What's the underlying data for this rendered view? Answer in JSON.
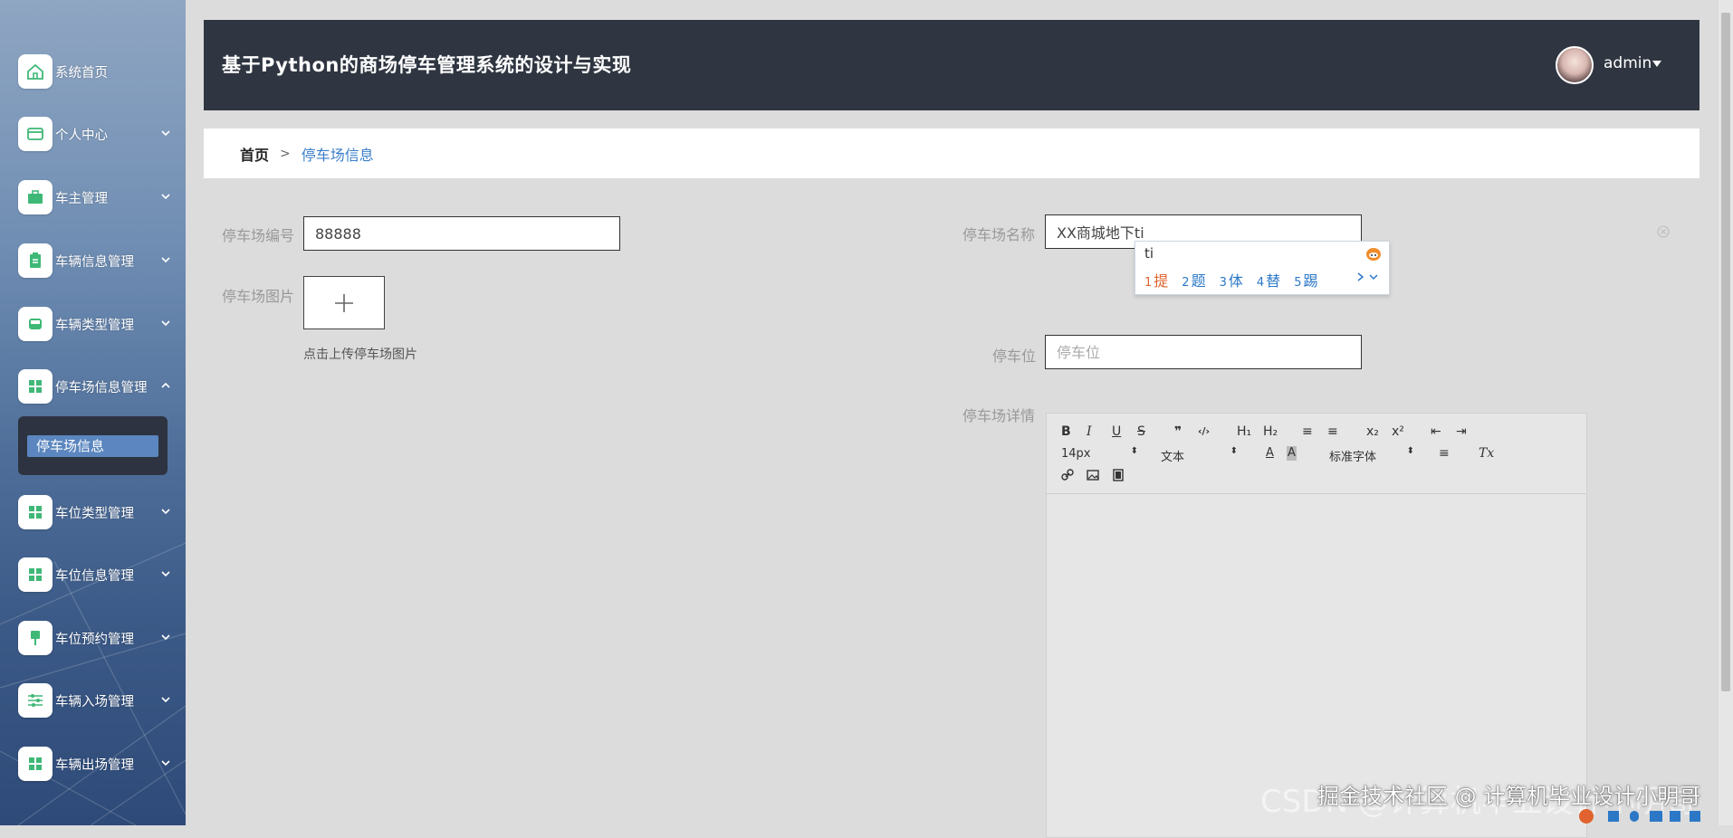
{
  "colors": {
    "header_bg": "#2f3641",
    "accent_link": "#3a7ec8",
    "submenu_active": "#5b86bf",
    "page_bg": "#dcdcdc"
  },
  "sidebar": {
    "items": [
      {
        "label": "系统首页",
        "icon": "home-icon"
      },
      {
        "label": "个人中心",
        "icon": "id-card-icon"
      },
      {
        "label": "车主管理",
        "icon": "briefcase-icon"
      },
      {
        "label": "车辆信息管理",
        "icon": "clipboard-icon"
      },
      {
        "label": "车辆类型管理",
        "icon": "car-icon"
      },
      {
        "label": "停车场信息管理",
        "icon": "grid-icon"
      },
      {
        "label": "车位类型管理",
        "icon": "grid-icon"
      },
      {
        "label": "车位信息管理",
        "icon": "grid-icon"
      },
      {
        "label": "车位预约管理",
        "icon": "pin-icon"
      },
      {
        "label": "车辆入场管理",
        "icon": "sliders-icon"
      },
      {
        "label": "车辆出场管理",
        "icon": "grid-icon"
      }
    ],
    "submenu": {
      "label": "停车场信息"
    }
  },
  "header": {
    "title": "基于Python的商场停车管理系统的设计与实现",
    "user": "admin"
  },
  "breadcrumb": {
    "home": "首页",
    "separator": ">",
    "current": "停车场信息"
  },
  "form": {
    "code_label": "停车场编号",
    "code_value": "88888",
    "name_label": "停车场名称",
    "name_value": "XX商城地下ti",
    "image_label": "停车场图片",
    "upload_hint": "点击上传停车场图片",
    "spots_label": "停车位",
    "spots_placeholder": "停车位",
    "detail_label": "停车场详情"
  },
  "ime": {
    "pinyin": "ti",
    "candidates": [
      {
        "n": "1",
        "c": "提"
      },
      {
        "n": "2",
        "c": "题"
      },
      {
        "n": "3",
        "c": "体"
      },
      {
        "n": "4",
        "c": "替"
      },
      {
        "n": "5",
        "c": "踢"
      }
    ]
  },
  "editor": {
    "font_size": "14px",
    "header_select": "文本",
    "font_family": "标准字体",
    "buttons": {
      "bold": "B",
      "italic": "I",
      "underline": "U",
      "strike": "S",
      "quote": "❞",
      "code": "‹/›",
      "h1": "H₁",
      "h2": "H₂",
      "ol": "≡",
      "ul": "≡",
      "sub": "x₂",
      "sup": "x²",
      "outdent": "⇤",
      "indent": "⇥",
      "color": "A",
      "background": "A",
      "align": "≡",
      "clean": "Tx"
    }
  },
  "watermark": {
    "back": "CSDN @计算机毕业设计小明哥",
    "front": "掘金技术社区 @ 计算机毕业设计小明哥"
  }
}
